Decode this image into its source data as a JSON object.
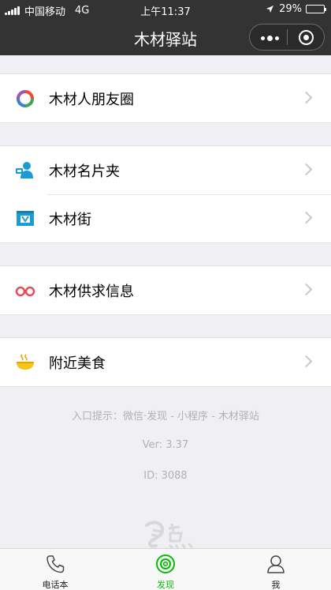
{
  "status_bar": {
    "carrier": "中国移动",
    "network": "4G",
    "time": "上午11:37",
    "battery": "29%",
    "battery_level": 0.29
  },
  "nav": {
    "title": "木材驿站"
  },
  "groups": [
    {
      "items": [
        {
          "label": "木材人朋友圈",
          "icon": "color-ring-icon"
        }
      ]
    },
    {
      "items": [
        {
          "label": "木材名片夹",
          "icon": "contact-card-icon"
        },
        {
          "label": "木材街",
          "icon": "shop-icon"
        }
      ]
    },
    {
      "items": [
        {
          "label": "木材供求信息",
          "icon": "glasses-icon"
        }
      ]
    },
    {
      "items": [
        {
          "label": "附近美食",
          "icon": "food-bowl-icon"
        }
      ]
    }
  ],
  "info": {
    "entry_hint": "入口提示：微信·发现 - 小程序 - 木材驿站",
    "version": "Ver: 3.37",
    "id": "ID: 3088"
  },
  "tabs": [
    {
      "label": "电话本",
      "icon": "phone-icon"
    },
    {
      "label": "发现",
      "icon": "discover-icon",
      "active": true
    },
    {
      "label": "我",
      "icon": "person-icon"
    }
  ],
  "colors": {
    "nav_bg": "#333333",
    "active_tab": "#09bb07",
    "page_bg": "#efeff4"
  }
}
